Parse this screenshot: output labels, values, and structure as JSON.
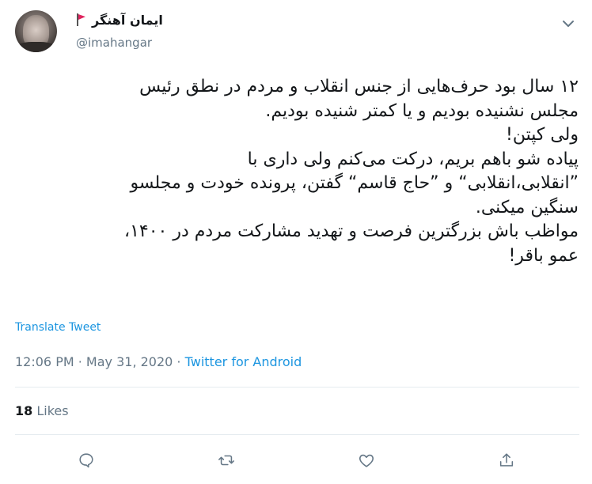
{
  "author": {
    "display_name": "ایمان آهنگر",
    "handle": "@imahangar",
    "flag_icon": "red-flag"
  },
  "tweet": {
    "lines": [
      "۱۲ سال بود حرف‌هایی از جنس انقلاب و مردم در نطق رئیس",
      "مجلس نشنیده بودیم و یا کمتر شنیده بودیم.",
      "ولی کپتن!",
      "پیاده شو باهم بریم، درکت می‌کنم ولی داری با",
      "”انقلابی،انقلابی“ و ”حاج قاسم“ گفتن، پرونده خودت و مجلسو",
      "سنگین میکنی.",
      "مواظب باش بزرگترین فرصت و تهدید مشارکت مردم در ۱۴۰۰،",
      "عمو باقر!"
    ],
    "translate_label": "Translate Tweet",
    "time": "12:06 PM",
    "separator1": " · ",
    "date": "May 31, 2020",
    "separator2": " · ",
    "source": "Twitter for Android"
  },
  "stats": {
    "likes_count": "18",
    "likes_label": "Likes"
  },
  "actions": {
    "reply_icon": "reply-icon",
    "retweet_icon": "retweet-icon",
    "like_icon": "heart-icon",
    "share_icon": "share-icon"
  },
  "colors": {
    "link": "#1b95e0",
    "secondary": "#657786",
    "text": "#14171a",
    "flag": "#e0245e"
  }
}
